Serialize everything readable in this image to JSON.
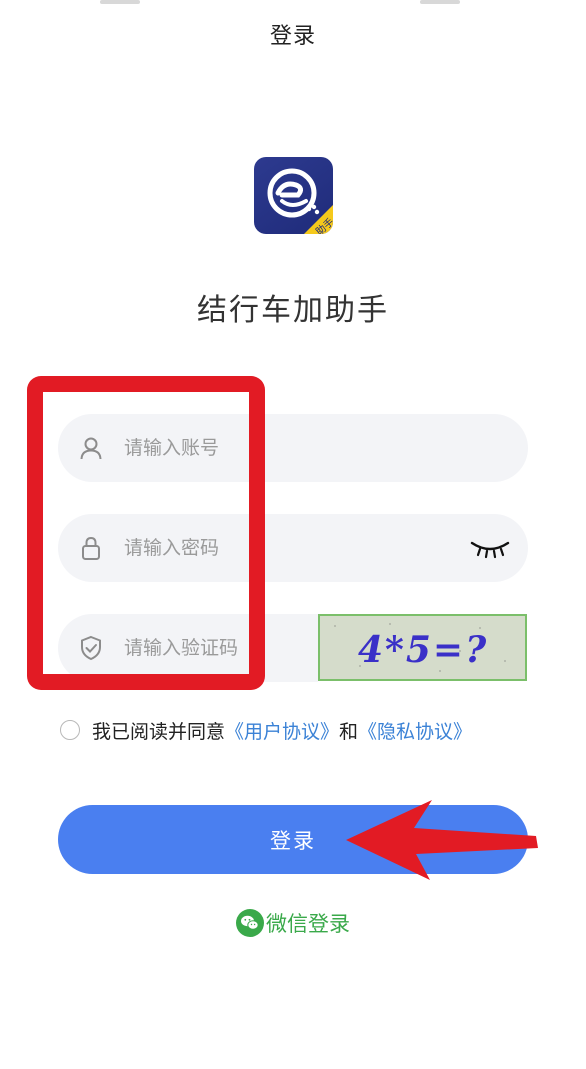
{
  "header": {
    "title": "登录"
  },
  "app": {
    "name": "结行车加助手",
    "logo_badge": "助手"
  },
  "form": {
    "account": {
      "placeholder": "请输入账号",
      "icon": "user-icon"
    },
    "password": {
      "placeholder": "请输入密码",
      "icon": "lock-icon",
      "toggle_icon": "eye-closed-icon"
    },
    "captcha": {
      "placeholder": "请输入验证码",
      "icon": "shield-check-icon",
      "image_text": "4*5=?"
    }
  },
  "agreement": {
    "prefix": "我已阅读并同意",
    "user_agreement": "《用户协议》",
    "and": "和",
    "privacy_policy": "《隐私协议》",
    "checked": false
  },
  "actions": {
    "login_label": "登录",
    "wechat_login_label": "微信登录"
  },
  "colors": {
    "primary": "#4a7ff0",
    "link": "#3b82d6",
    "wechat": "#3aa94a",
    "annotation_red": "#e21b24",
    "field_bg": "#f3f4f7"
  }
}
